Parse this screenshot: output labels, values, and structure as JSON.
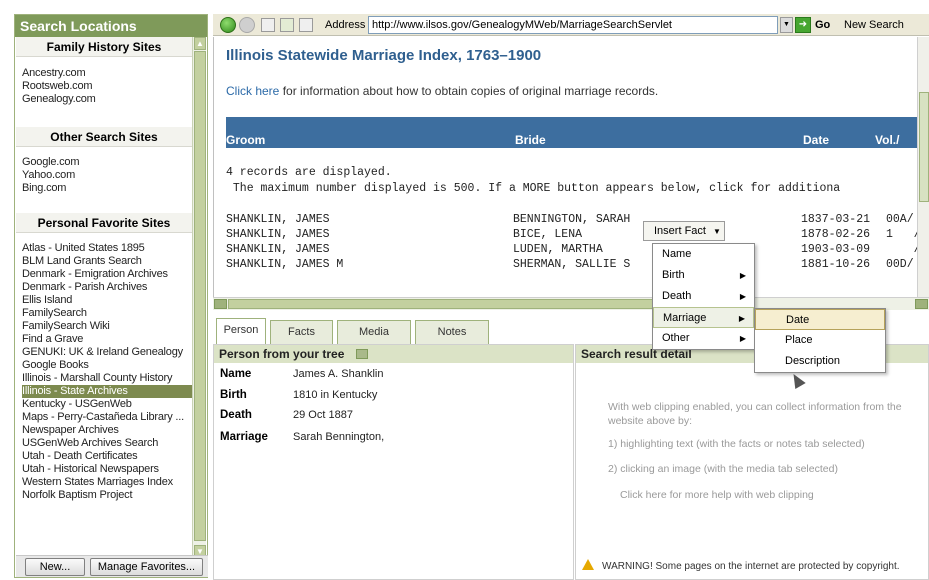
{
  "sidebar": {
    "title": "Search Locations",
    "sections": [
      {
        "title": "Family History Sites",
        "items": [
          "Ancestry.com",
          "Rootsweb.com",
          "Genealogy.com"
        ]
      },
      {
        "title": "Other Search Sites",
        "items": [
          "Google.com",
          "Yahoo.com",
          "Bing.com"
        ]
      },
      {
        "title": "Personal Favorite Sites",
        "items": [
          "Atlas - United States 1895",
          "BLM Land Grants Search",
          "Denmark - Emigration Archives",
          "Denmark - Parish Archives",
          "Ellis Island",
          "FamilySearch",
          "FamilySearch Wiki",
          "Find a Grave",
          "GENUKI: UK & Ireland Genealogy",
          "Google Books",
          "Illinois - Marshall County History",
          "Illinois - State Archives",
          "Kentucky - USGenWeb",
          "Maps - Perry-Castañeda Library ...",
          "Newspaper Archives",
          "USGenWeb Archives Search",
          "Utah - Death Certificates",
          "Utah - Historical Newspapers",
          "Western States Marriages Index",
          "Norfolk Baptism Project"
        ]
      }
    ],
    "selected_item": "Illinois - State Archives",
    "buttons": {
      "new": "New...",
      "manage": "Manage Favorites..."
    }
  },
  "toolbar": {
    "address_label": "Address",
    "url": "http://www.ilsos.gov/GenealogyMWeb/MarriageSearchServlet",
    "go_label": "Go",
    "new_search_label": "New Search"
  },
  "page": {
    "title": "Illinois Statewide Marriage Index, 1763–1900",
    "info_link": "Click here",
    "info_text": " for information about how to obtain copies of original marriage records.",
    "columns": {
      "groom": "Groom",
      "bride": "Bride",
      "date": "Date",
      "vol": "Vol./"
    },
    "count_line": "4 records are displayed.",
    "max_line": " The maximum number displayed is 500. If a MORE button appears below, click for additiona",
    "records": [
      {
        "groom": "SHANKLIN, JAMES",
        "bride": "BENNINGTON, SARAH",
        "date": "1837-03-21",
        "vol": "00A/"
      },
      {
        "groom": "SHANKLIN, JAMES",
        "bride": "BICE, LENA",
        "date": "1878-02-26",
        "vol": "1   /"
      },
      {
        "groom": "SHANKLIN, JAMES",
        "bride": "LUDEN, MARTHA",
        "date": "1903-03-09",
        "vol": "    /"
      },
      {
        "groom": "SHANKLIN, JAMES M",
        "bride": "SHERMAN, SALLIE S",
        "date": "1881-10-26",
        "vol": "00D/"
      }
    ]
  },
  "tabs": [
    "Person",
    "Facts",
    "Media",
    "Notes"
  ],
  "active_tab": "Person",
  "person_panel": {
    "title": "Person from your tree",
    "facts": [
      {
        "label": "Name",
        "value": "James A. Shanklin"
      },
      {
        "label": "Birth",
        "value": "1810 in Kentucky"
      },
      {
        "label": "Death",
        "value": "29 Oct 1887"
      },
      {
        "label": "Marriage",
        "value": "Sarah Bennington,"
      }
    ]
  },
  "detail_panel": {
    "title": "Search result detail",
    "hint_line1": "With web clipping enabled, you can collect information from the",
    "hint_line2": "website above by:",
    "hint_step1": "1) highlighting text (with the facts or notes tab selected)",
    "hint_step2": "2) clicking an image (with the media tab selected)",
    "hint_help": "Click here for more help with web clipping",
    "warning": "WARNING!  Some pages on the internet are protected by copyright."
  },
  "context_menu": {
    "button_label": "Insert Fact",
    "items": [
      "Name",
      "Birth",
      "Death",
      "Marriage",
      "Other"
    ],
    "highlighted": "Marriage",
    "submenu": [
      "Date",
      "Place",
      "Description"
    ],
    "submenu_highlighted": "Date"
  },
  "colors": {
    "sidebar_header": "#7f9a5a",
    "selected_item": "#7d8a4f",
    "result_header": "#3d6e9f",
    "page_title": "#2f5f8f"
  }
}
